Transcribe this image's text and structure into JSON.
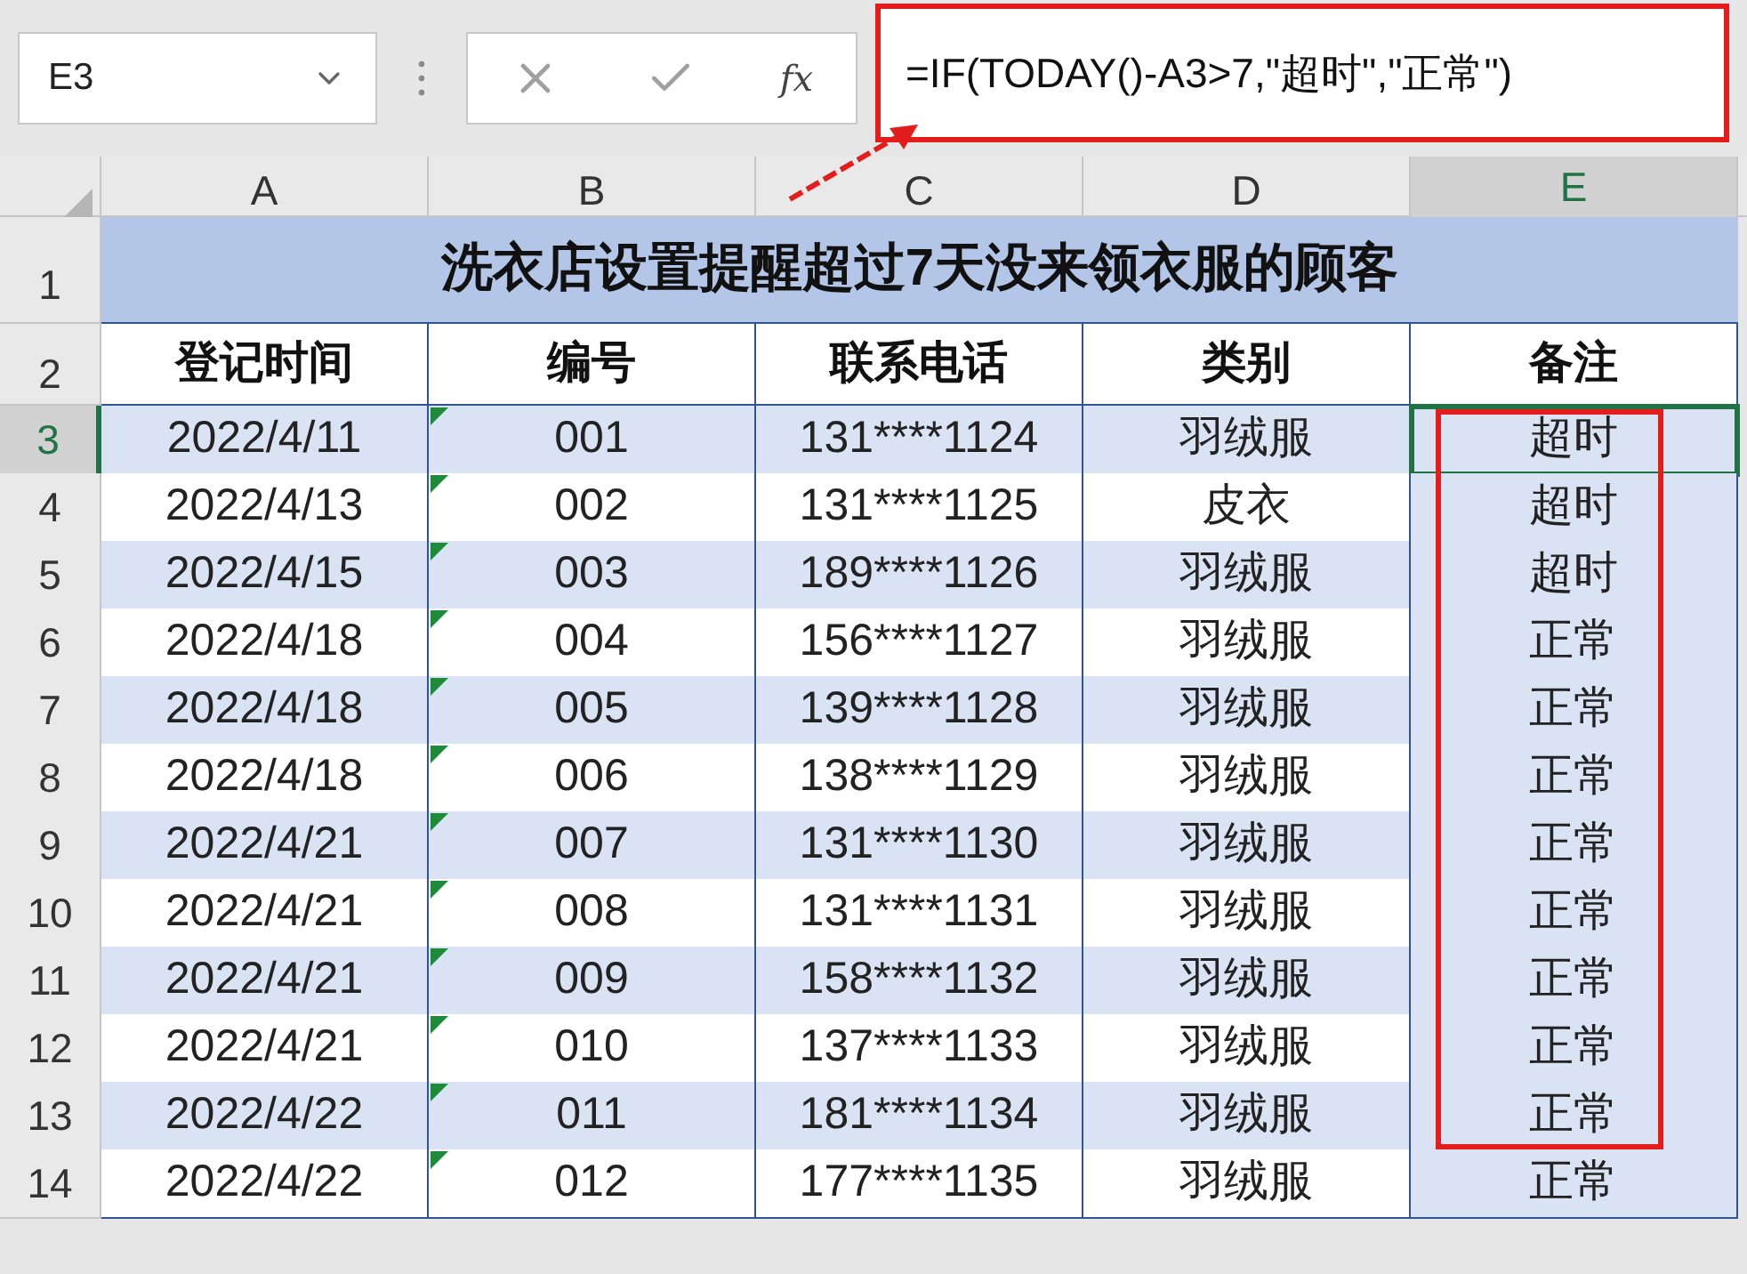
{
  "name_box": {
    "value": "E3"
  },
  "formula_bar": {
    "function_label": "fx",
    "formula": "=IF(TODAY()-A3>7,\"超时\",\"正常\")"
  },
  "columns": [
    {
      "label": "A",
      "selected": false
    },
    {
      "label": "B",
      "selected": false
    },
    {
      "label": "C",
      "selected": false
    },
    {
      "label": "D",
      "selected": false
    },
    {
      "label": "E",
      "selected": true
    }
  ],
  "sheet": {
    "title_row": "1",
    "title": "洗衣店设置提醒超过7天没来领衣服的顾客",
    "header_row": "2",
    "headers": [
      "登记时间",
      "编号",
      "联系电话",
      "类别",
      "备注"
    ],
    "rows": [
      {
        "row": "3",
        "selected": true,
        "flag": true,
        "cells": [
          "2022/4/11",
          "001",
          "131****1124",
          "羽绒服",
          "超时"
        ]
      },
      {
        "row": "4",
        "selected": false,
        "flag": true,
        "cells": [
          "2022/4/13",
          "002",
          "131****1125",
          "皮衣",
          "超时"
        ]
      },
      {
        "row": "5",
        "selected": false,
        "flag": true,
        "cells": [
          "2022/4/15",
          "003",
          "189****1126",
          "羽绒服",
          "超时"
        ]
      },
      {
        "row": "6",
        "selected": false,
        "flag": true,
        "cells": [
          "2022/4/18",
          "004",
          "156****1127",
          "羽绒服",
          "正常"
        ]
      },
      {
        "row": "7",
        "selected": false,
        "flag": true,
        "cells": [
          "2022/4/18",
          "005",
          "139****1128",
          "羽绒服",
          "正常"
        ]
      },
      {
        "row": "8",
        "selected": false,
        "flag": true,
        "cells": [
          "2022/4/18",
          "006",
          "138****1129",
          "羽绒服",
          "正常"
        ]
      },
      {
        "row": "9",
        "selected": false,
        "flag": true,
        "cells": [
          "2022/4/21",
          "007",
          "131****1130",
          "羽绒服",
          "正常"
        ]
      },
      {
        "row": "10",
        "selected": false,
        "flag": true,
        "cells": [
          "2022/4/21",
          "008",
          "131****1131",
          "羽绒服",
          "正常"
        ]
      },
      {
        "row": "11",
        "selected": false,
        "flag": true,
        "cells": [
          "2022/4/21",
          "009",
          "158****1132",
          "羽绒服",
          "正常"
        ]
      },
      {
        "row": "12",
        "selected": false,
        "flag": true,
        "cells": [
          "2022/4/21",
          "010",
          "137****1133",
          "羽绒服",
          "正常"
        ]
      },
      {
        "row": "13",
        "selected": false,
        "flag": true,
        "cells": [
          "2022/4/22",
          "011",
          "181****1134",
          "羽绒服",
          "正常"
        ]
      },
      {
        "row": "14",
        "selected": false,
        "flag": true,
        "cells": [
          "2022/4/22",
          "012",
          "177****1135",
          "羽绒服",
          "正常"
        ]
      }
    ]
  }
}
